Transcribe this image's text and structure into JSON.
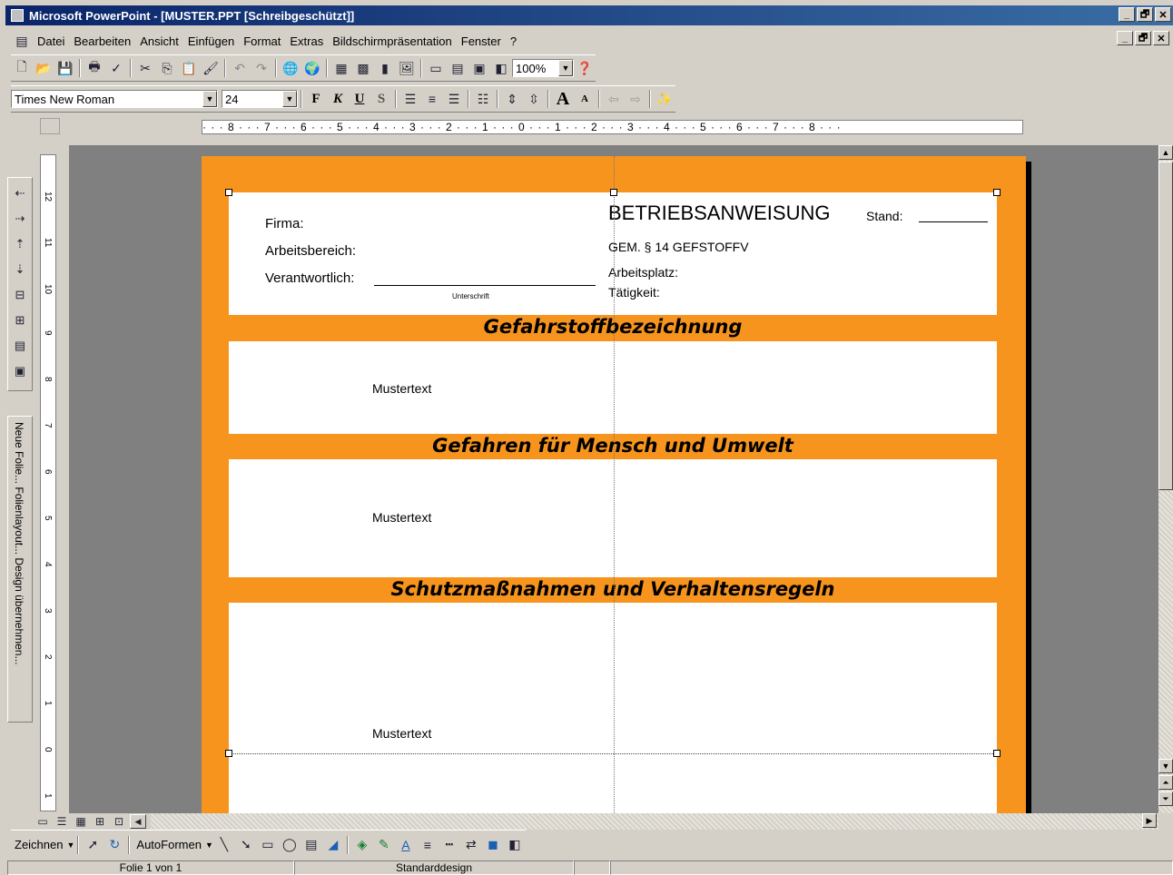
{
  "window": {
    "title": "Microsoft PowerPoint - [MUSTER.PPT [Schreibgeschützt]]",
    "controls": [
      "_",
      "🗗",
      "✕"
    ],
    "doc_controls": [
      "_",
      "🗗",
      "✕"
    ]
  },
  "menu": [
    "Datei",
    "Bearbeiten",
    "Ansicht",
    "Einfügen",
    "Format",
    "Extras",
    "Bildschirmpräsentation",
    "Fenster",
    "?"
  ],
  "standard_toolbar": {
    "zoom": "100%"
  },
  "format_toolbar": {
    "font": "Times New Roman",
    "size": "24",
    "bold": "F",
    "italic": "K",
    "underline": "U",
    "shadow": "S"
  },
  "ruler": {
    "horizontal": "· · · 8 · · · 7 · · · 6 · · · 5 · · · 4 · · · 3 · · · 2 · · · 1 · · · 0 · · · 1 · · · 2 · · · 3 · · · 4 · · · 5 · · · 6 · · · 7 · · · 8 · · ·",
    "vertical_labels": [
      "12",
      "11",
      "10",
      "9",
      "8",
      "7",
      "6",
      "5",
      "4",
      "3",
      "2",
      "1",
      "0",
      "1"
    ]
  },
  "side_panel": {
    "text": "Neue Folie...   Folienlayout...   Design übernehmen..."
  },
  "slide": {
    "header": {
      "firma": "Firma:",
      "arbeitsbereich": "Arbeitsbereich:",
      "verantwortlich": "Verantwortlich:",
      "unterschrift": "Unterschrift",
      "title": "BETRIEBSANWEISUNG",
      "stand": "Stand:",
      "gem": "GEM. § 14 GEFSTOFFV",
      "arbeitsplatz": "Arbeitsplatz:",
      "taetigkeit": "Tätigkeit:"
    },
    "sections": [
      {
        "title": "Gefahrstoffbezeichnung",
        "text": "Mustertext"
      },
      {
        "title": "Gefahren für Mensch und Umwelt",
        "text": "Mustertext"
      },
      {
        "title": "Schutzmaßnahmen und Verhaltensregeln",
        "text": "Mustertext"
      }
    ]
  },
  "drawing_toolbar": {
    "draw": "Zeichnen",
    "autoshapes": "AutoFormen"
  },
  "status": {
    "slide": "Folie 1 von 1",
    "design": "Standarddesign"
  },
  "colors": {
    "slide_background": "#f7941d",
    "titlebar": "#0a246a"
  }
}
